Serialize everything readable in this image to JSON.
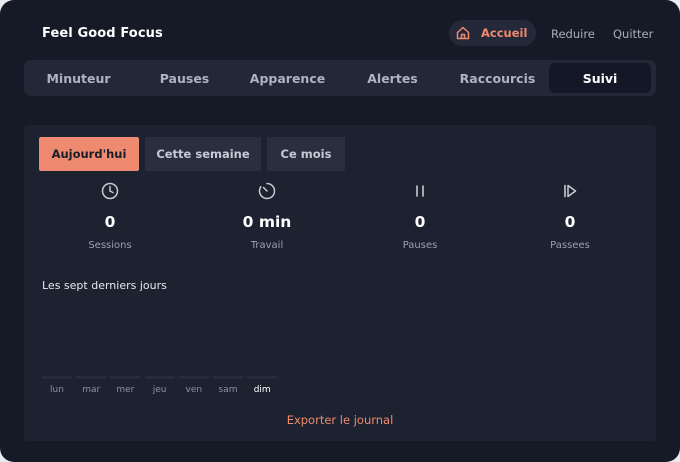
{
  "header": {
    "app_title": "Feel Good Focus",
    "home_label": "Accueil",
    "reduce_label": "Reduire",
    "quit_label": "Quitter"
  },
  "tabs": [
    {
      "label": "Minuteur",
      "active": false
    },
    {
      "label": "Pauses",
      "active": false
    },
    {
      "label": "Apparence",
      "active": false
    },
    {
      "label": "Alertes",
      "active": false
    },
    {
      "label": "Raccourcis",
      "active": false
    },
    {
      "label": "Suivi",
      "active": true
    }
  ],
  "periods": [
    {
      "label": "Aujourd'hui",
      "active": true
    },
    {
      "label": "Cette semaine",
      "active": false
    },
    {
      "label": "Ce mois",
      "active": false
    }
  ],
  "stats": [
    {
      "icon": "clock-icon",
      "value": "0",
      "label": "Sessions"
    },
    {
      "icon": "timer-icon",
      "value": "0 min",
      "label": "Travail"
    },
    {
      "icon": "pause-icon",
      "value": "0",
      "label": "Pauses"
    },
    {
      "icon": "skip-icon",
      "value": "0",
      "label": "Passees"
    }
  ],
  "chart": {
    "title": "Les sept derniers jours"
  },
  "chart_data": {
    "type": "bar",
    "categories": [
      "lun",
      "mar",
      "mer",
      "jeu",
      "ven",
      "sam",
      "dim"
    ],
    "values": [
      0,
      0,
      0,
      0,
      0,
      0,
      0
    ],
    "highlighted_category": "dim",
    "title": "Les sept derniers jours"
  },
  "footer": {
    "export_label": "Exporter le journal"
  },
  "colors": {
    "accent": "#ee8a6f",
    "background": "#161a27",
    "panel": "#1d2231"
  }
}
